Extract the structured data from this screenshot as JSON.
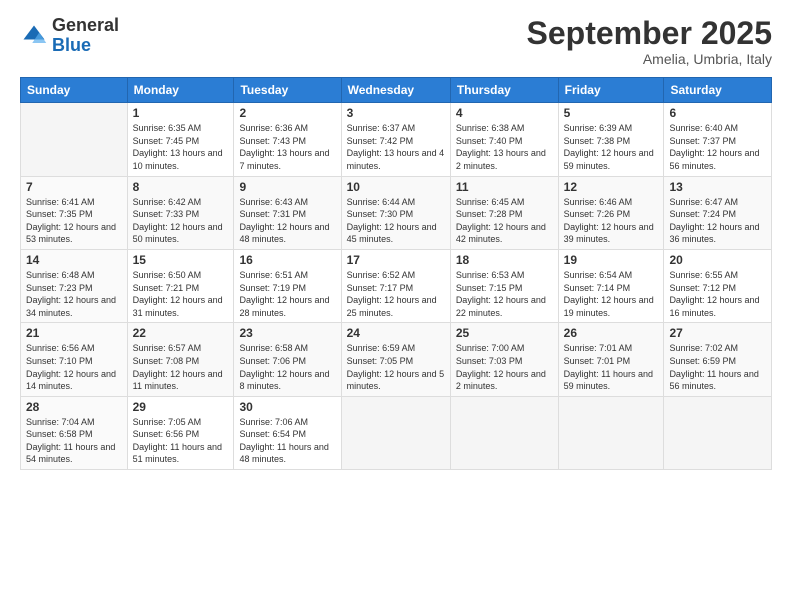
{
  "header": {
    "logo_general": "General",
    "logo_blue": "Blue",
    "month": "September 2025",
    "location": "Amelia, Umbria, Italy"
  },
  "days_of_week": [
    "Sunday",
    "Monday",
    "Tuesday",
    "Wednesday",
    "Thursday",
    "Friday",
    "Saturday"
  ],
  "weeks": [
    [
      {
        "day": "",
        "info": ""
      },
      {
        "day": "1",
        "info": "Sunrise: 6:35 AM\nSunset: 7:45 PM\nDaylight: 13 hours\nand 10 minutes."
      },
      {
        "day": "2",
        "info": "Sunrise: 6:36 AM\nSunset: 7:43 PM\nDaylight: 13 hours\nand 7 minutes."
      },
      {
        "day": "3",
        "info": "Sunrise: 6:37 AM\nSunset: 7:42 PM\nDaylight: 13 hours\nand 4 minutes."
      },
      {
        "day": "4",
        "info": "Sunrise: 6:38 AM\nSunset: 7:40 PM\nDaylight: 13 hours\nand 2 minutes."
      },
      {
        "day": "5",
        "info": "Sunrise: 6:39 AM\nSunset: 7:38 PM\nDaylight: 12 hours\nand 59 minutes."
      },
      {
        "day": "6",
        "info": "Sunrise: 6:40 AM\nSunset: 7:37 PM\nDaylight: 12 hours\nand 56 minutes."
      }
    ],
    [
      {
        "day": "7",
        "info": "Sunrise: 6:41 AM\nSunset: 7:35 PM\nDaylight: 12 hours\nand 53 minutes."
      },
      {
        "day": "8",
        "info": "Sunrise: 6:42 AM\nSunset: 7:33 PM\nDaylight: 12 hours\nand 50 minutes."
      },
      {
        "day": "9",
        "info": "Sunrise: 6:43 AM\nSunset: 7:31 PM\nDaylight: 12 hours\nand 48 minutes."
      },
      {
        "day": "10",
        "info": "Sunrise: 6:44 AM\nSunset: 7:30 PM\nDaylight: 12 hours\nand 45 minutes."
      },
      {
        "day": "11",
        "info": "Sunrise: 6:45 AM\nSunset: 7:28 PM\nDaylight: 12 hours\nand 42 minutes."
      },
      {
        "day": "12",
        "info": "Sunrise: 6:46 AM\nSunset: 7:26 PM\nDaylight: 12 hours\nand 39 minutes."
      },
      {
        "day": "13",
        "info": "Sunrise: 6:47 AM\nSunset: 7:24 PM\nDaylight: 12 hours\nand 36 minutes."
      }
    ],
    [
      {
        "day": "14",
        "info": "Sunrise: 6:48 AM\nSunset: 7:23 PM\nDaylight: 12 hours\nand 34 minutes."
      },
      {
        "day": "15",
        "info": "Sunrise: 6:50 AM\nSunset: 7:21 PM\nDaylight: 12 hours\nand 31 minutes."
      },
      {
        "day": "16",
        "info": "Sunrise: 6:51 AM\nSunset: 7:19 PM\nDaylight: 12 hours\nand 28 minutes."
      },
      {
        "day": "17",
        "info": "Sunrise: 6:52 AM\nSunset: 7:17 PM\nDaylight: 12 hours\nand 25 minutes."
      },
      {
        "day": "18",
        "info": "Sunrise: 6:53 AM\nSunset: 7:15 PM\nDaylight: 12 hours\nand 22 minutes."
      },
      {
        "day": "19",
        "info": "Sunrise: 6:54 AM\nSunset: 7:14 PM\nDaylight: 12 hours\nand 19 minutes."
      },
      {
        "day": "20",
        "info": "Sunrise: 6:55 AM\nSunset: 7:12 PM\nDaylight: 12 hours\nand 16 minutes."
      }
    ],
    [
      {
        "day": "21",
        "info": "Sunrise: 6:56 AM\nSunset: 7:10 PM\nDaylight: 12 hours\nand 14 minutes."
      },
      {
        "day": "22",
        "info": "Sunrise: 6:57 AM\nSunset: 7:08 PM\nDaylight: 12 hours\nand 11 minutes."
      },
      {
        "day": "23",
        "info": "Sunrise: 6:58 AM\nSunset: 7:06 PM\nDaylight: 12 hours\nand 8 minutes."
      },
      {
        "day": "24",
        "info": "Sunrise: 6:59 AM\nSunset: 7:05 PM\nDaylight: 12 hours\nand 5 minutes."
      },
      {
        "day": "25",
        "info": "Sunrise: 7:00 AM\nSunset: 7:03 PM\nDaylight: 12 hours\nand 2 minutes."
      },
      {
        "day": "26",
        "info": "Sunrise: 7:01 AM\nSunset: 7:01 PM\nDaylight: 11 hours\nand 59 minutes."
      },
      {
        "day": "27",
        "info": "Sunrise: 7:02 AM\nSunset: 6:59 PM\nDaylight: 11 hours\nand 56 minutes."
      }
    ],
    [
      {
        "day": "28",
        "info": "Sunrise: 7:04 AM\nSunset: 6:58 PM\nDaylight: 11 hours\nand 54 minutes."
      },
      {
        "day": "29",
        "info": "Sunrise: 7:05 AM\nSunset: 6:56 PM\nDaylight: 11 hours\nand 51 minutes."
      },
      {
        "day": "30",
        "info": "Sunrise: 7:06 AM\nSunset: 6:54 PM\nDaylight: 11 hours\nand 48 minutes."
      },
      {
        "day": "",
        "info": ""
      },
      {
        "day": "",
        "info": ""
      },
      {
        "day": "",
        "info": ""
      },
      {
        "day": "",
        "info": ""
      }
    ]
  ]
}
